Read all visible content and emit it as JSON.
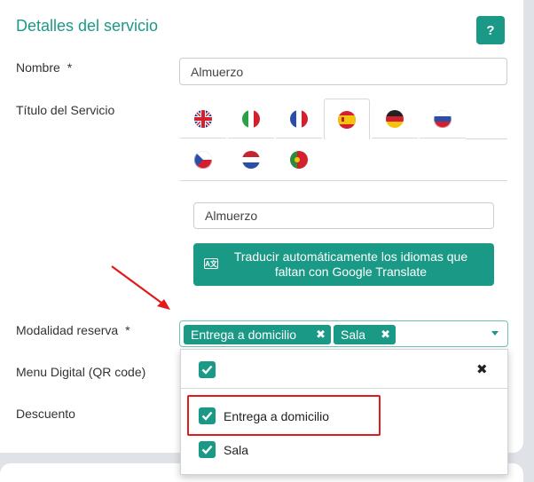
{
  "section": {
    "title": "Detalles del servicio",
    "help_label": "?"
  },
  "fields": {
    "nombre_label": "Nombre",
    "nombre_required": "*",
    "nombre_value": "Almuerzo",
    "titulo_label": "Título del Servicio",
    "titulo_value": "Almuerzo",
    "modalidad_label": "Modalidad reserva",
    "modalidad_required": "*",
    "menu_label": "Menu Digital (QR code)",
    "descuento_label": "Descuento"
  },
  "language_tabs": [
    {
      "icon": "flag-uk-icon",
      "active": false
    },
    {
      "icon": "flag-it-icon",
      "active": false
    },
    {
      "icon": "flag-fr-icon",
      "active": false
    },
    {
      "icon": "flag-es-icon",
      "active": true
    },
    {
      "icon": "flag-de-icon",
      "active": false
    },
    {
      "icon": "flag-ru-icon",
      "active": false
    },
    {
      "icon": "flag-cz-icon",
      "active": false
    },
    {
      "icon": "flag-nl-icon",
      "active": false
    },
    {
      "icon": "flag-pt-icon",
      "active": false
    }
  ],
  "translate_button": {
    "label": "Traducir automáticamente los idiomas que faltan con Google Translate",
    "icon": "translate-icon",
    "icon_text": "A文"
  },
  "modalidad_select": {
    "chips": [
      "Entrega a domicilio",
      "Sala"
    ],
    "chip_remove_glyph": "✖",
    "options": [
      {
        "label": "Entrega a domicilio",
        "checked": true,
        "highlighted": true
      },
      {
        "label": "Sala",
        "checked": true,
        "highlighted": false
      }
    ],
    "select_all_checked": true,
    "close_glyph": "✖"
  },
  "colors": {
    "accent": "#1a9a86",
    "highlight": "#e01b1b",
    "background": "#dfe2e7"
  }
}
